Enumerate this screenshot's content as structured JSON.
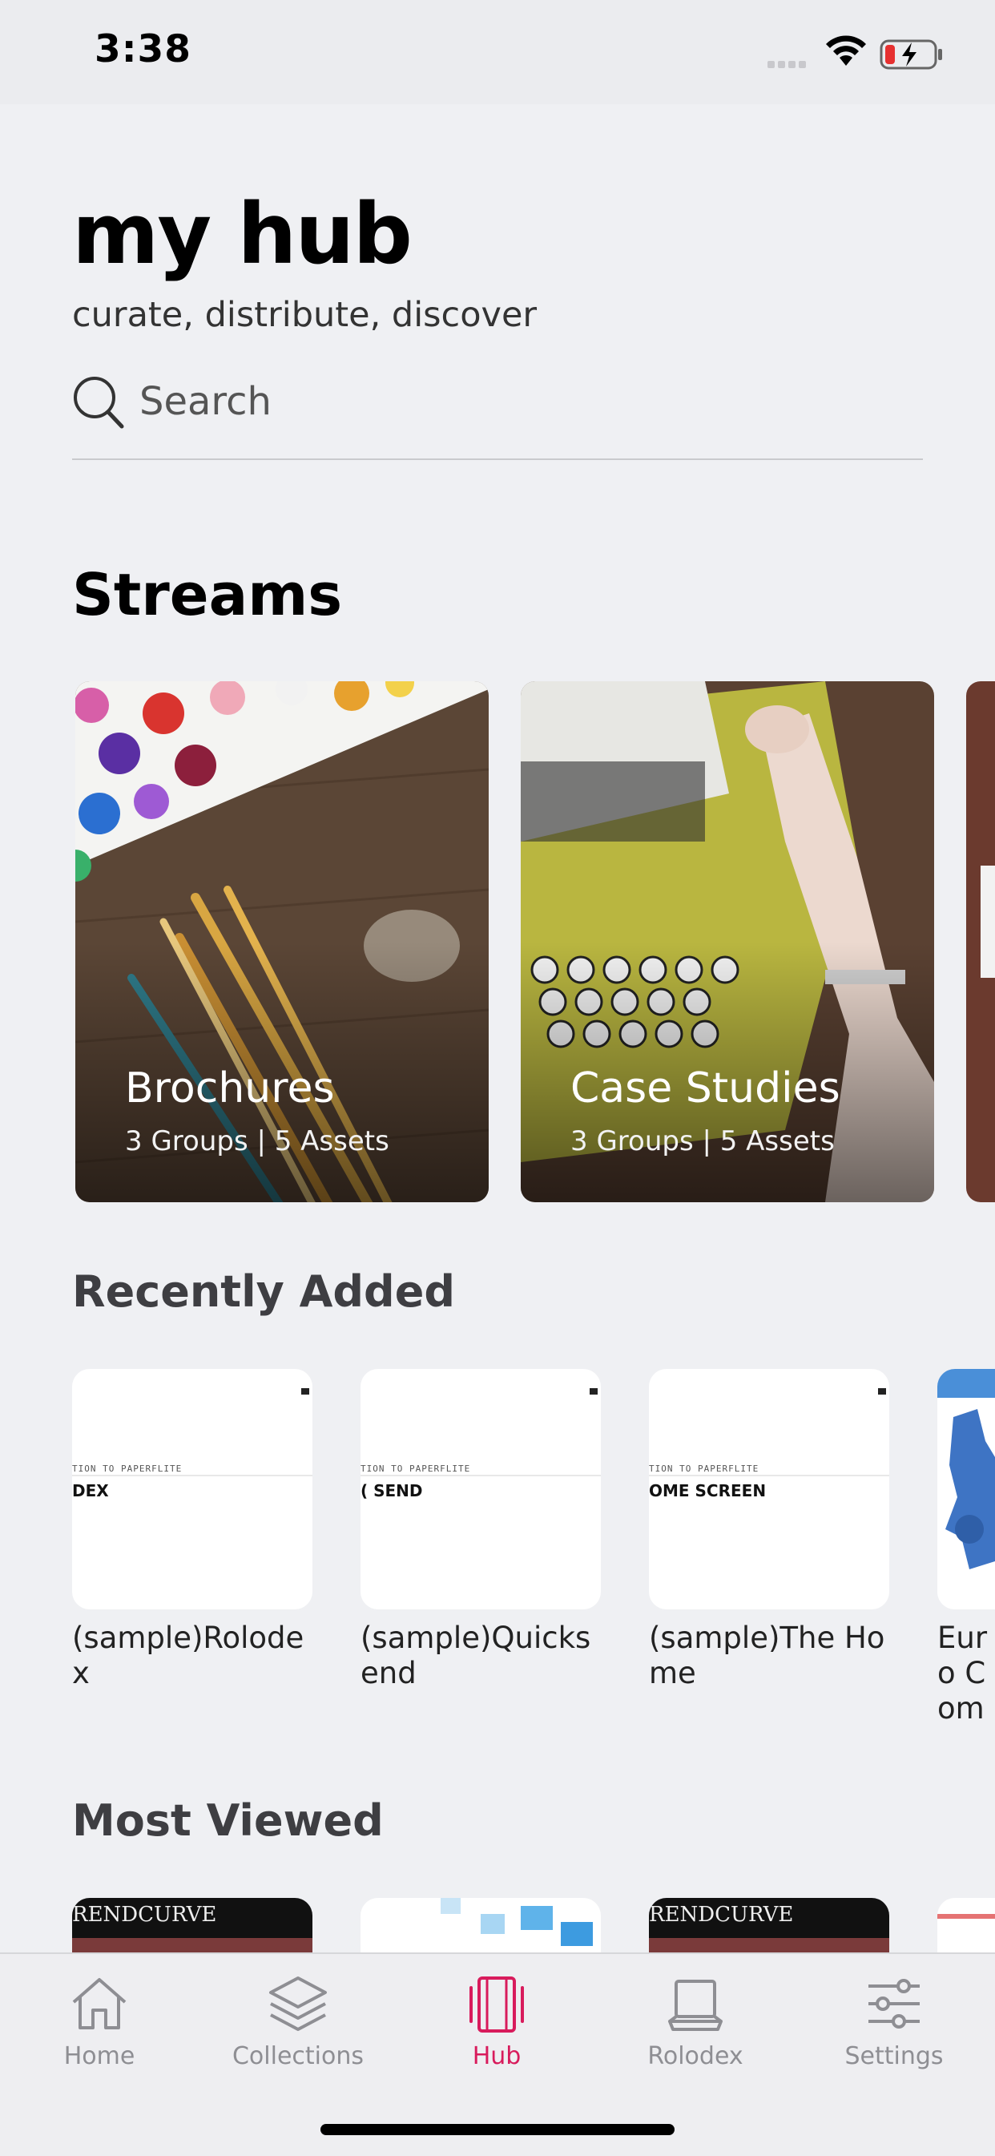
{
  "status_bar": {
    "time": "3:38"
  },
  "header": {
    "title": "my hub",
    "subtitle": "curate, distribute, discover",
    "search_placeholder": "Search"
  },
  "streams": {
    "title": "Streams",
    "items": [
      {
        "name": "Brochures",
        "meta": "3 Groups | 5 Assets"
      },
      {
        "name": "Case Studies",
        "meta": "3 Groups | 5 Assets"
      }
    ]
  },
  "recently_added": {
    "title": "Recently Added",
    "items": [
      {
        "label": "(sample)Rolodex",
        "thumb_small": "TION TO PAPERFLITE",
        "thumb_big": "DEX"
      },
      {
        "label": "(sample)Quicksend",
        "thumb_small": "TION TO PAPERFLITE",
        "thumb_big": "( SEND"
      },
      {
        "label": "(sample)The Home",
        "thumb_small": "TION TO PAPERFLITE",
        "thumb_big": "OME SCREEN"
      },
      {
        "label": "Euro Com"
      }
    ]
  },
  "most_viewed": {
    "title": "Most Viewed",
    "items": [
      {
        "thumb_text": "RENDCURVE"
      },
      {
        "thumb_text": ""
      },
      {
        "thumb_text": "RENDCURVE"
      },
      {
        "thumb_text": ""
      }
    ]
  },
  "tab_bar": {
    "tabs": [
      {
        "label": "Home",
        "icon": "home-icon"
      },
      {
        "label": "Collections",
        "icon": "layers-icon"
      },
      {
        "label": "Hub",
        "icon": "hub-icon"
      },
      {
        "label": "Rolodex",
        "icon": "rolodex-icon"
      },
      {
        "label": "Settings",
        "icon": "sliders-icon"
      }
    ],
    "active": "Hub"
  },
  "colors": {
    "accent": "#d81b5c",
    "background": "#eff0f3",
    "inactive": "#8e8e93"
  }
}
